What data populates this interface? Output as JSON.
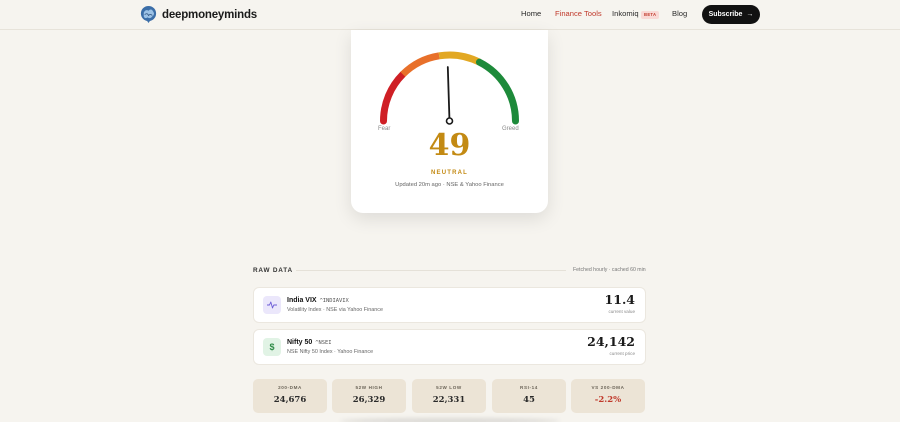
{
  "brand": {
    "name": "deepmoneyminds"
  },
  "nav": {
    "items": [
      {
        "label": "Home"
      },
      {
        "label": "Finance Tools"
      },
      {
        "label": "Inkomiq"
      },
      {
        "label": "Blog"
      }
    ],
    "beta_badge": "BETA",
    "subscribe_label": "Subscribe",
    "subscribe_arrow": "→"
  },
  "gauge": {
    "value": 49,
    "min_label": "Fear",
    "max_label": "Greed",
    "sentiment": "NEUTRAL",
    "updated": "Updated 20m ago · NSE & Yahoo Finance",
    "colors": {
      "fear": "#cf1f25",
      "orange": "#e8702a",
      "amber": "#e2a823",
      "greed": "#1d8a3a",
      "accent": "#c38a13"
    }
  },
  "raw_data": {
    "title": "RAW DATA",
    "note": "Fetched hourly · cached 60 min",
    "rows": [
      {
        "icon": "activity-icon",
        "name": "India VIX",
        "symbol": "^INDIAVIX",
        "desc": "Volatility Index · NSE via Yahoo Finance",
        "value": "11.4",
        "sub": "current value",
        "icon_bg": "#ebe7fb",
        "icon_color": "#6b5bd6"
      },
      {
        "icon": "dollar-icon",
        "name": "Nifty 50",
        "symbol": "^NSEI",
        "desc": "NSE Nifty 50 Index · Yahoo Finance",
        "value": "24,142",
        "sub": "current price",
        "icon_bg": "#e1f3e5",
        "icon_color": "#2e8b47"
      }
    ],
    "stats": [
      {
        "label": "200-DMA",
        "value": "24,676"
      },
      {
        "label": "52W HIGH",
        "value": "26,329"
      },
      {
        "label": "52W LOW",
        "value": "22,331"
      },
      {
        "label": "RSI-14",
        "value": "45"
      },
      {
        "label": "VS 200-DMA",
        "value": "-2.2%"
      }
    ]
  }
}
